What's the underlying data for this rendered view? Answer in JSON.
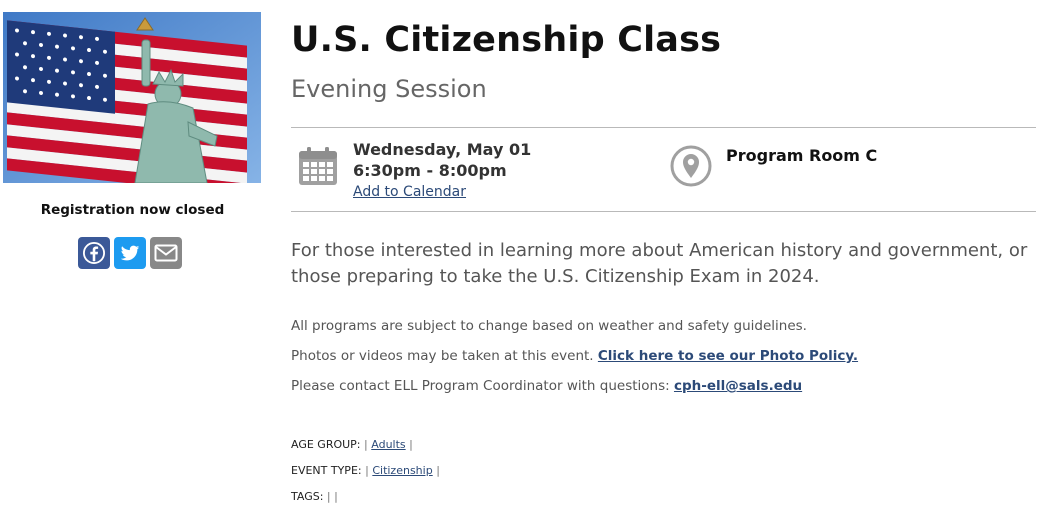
{
  "event": {
    "title": "U.S. Citizenship Class",
    "subtitle": "Evening Session",
    "date": "Wednesday, May 01",
    "time": "6:30pm - 8:00pm",
    "add_to_calendar": "Add to Calendar",
    "location": "Program Room C",
    "description": "For those interested in learning more about American history and government, or those preparing to take the U.S. Citizenship Exam in 2024."
  },
  "sidebar": {
    "registration_status": "Registration now closed",
    "share": [
      {
        "name": "facebook",
        "color": "#3b5998"
      },
      {
        "name": "twitter",
        "color": "#1d9bf0"
      },
      {
        "name": "email",
        "color": "#888888"
      }
    ]
  },
  "notes": {
    "line1": "All programs are subject to change based on weather and safety guidelines.",
    "line2_text": "Photos or videos may be taken at this event.",
    "line2_link": "Click here to see our Photo Policy.",
    "line3_text": "Please contact ELL Program Coordinator with questions:",
    "line3_link": "cph-ell@sals.edu"
  },
  "meta": {
    "age_group_label": "AGE GROUP:",
    "age_group_value": "Adults",
    "event_type_label": "EVENT TYPE:",
    "event_type_value": "Citizenship",
    "tags_label": "TAGS:",
    "separator": "|"
  },
  "colors": {
    "link": "#2c4a78",
    "rule": "#b9b9b9",
    "icon_gray": "#a0a0a0"
  },
  "icons": [
    "calendar-icon",
    "map-pin-icon",
    "facebook-icon",
    "twitter-icon",
    "email-icon"
  ]
}
